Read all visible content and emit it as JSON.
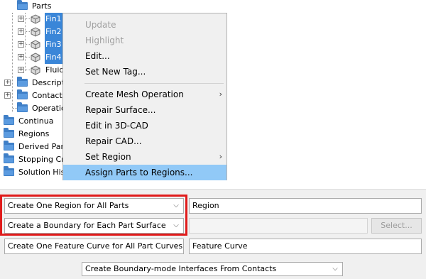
{
  "tree": {
    "items": [
      {
        "label": "Parts",
        "kind": "folder"
      },
      {
        "label": "Fin1",
        "kind": "part",
        "selected": true
      },
      {
        "label": "Fin2",
        "kind": "part",
        "selected": true
      },
      {
        "label": "Fin3",
        "kind": "part",
        "selected": true
      },
      {
        "label": "Fin4",
        "kind": "part",
        "selected": true
      },
      {
        "label": "Fluid",
        "kind": "part",
        "selected": false
      },
      {
        "label": "Descriptions",
        "kind": "folder"
      },
      {
        "label": "Contacts",
        "kind": "folder"
      },
      {
        "label": "Operations",
        "kind": "folder"
      },
      {
        "label": "Continua",
        "kind": "folder"
      },
      {
        "label": "Regions",
        "kind": "folder"
      },
      {
        "label": "Derived Parts",
        "kind": "folder"
      },
      {
        "label": "Stopping Criteria",
        "kind": "folder"
      },
      {
        "label": "Solution Histories",
        "kind": "folder"
      }
    ]
  },
  "context_menu": {
    "items": [
      {
        "label": "Update",
        "disabled": true
      },
      {
        "label": "Highlight",
        "disabled": true
      },
      {
        "label": "Edit..."
      },
      {
        "label": "Set New Tag..."
      },
      {
        "label": "Create Mesh Operation",
        "submenu": true
      },
      {
        "label": "Repair Surface..."
      },
      {
        "label": "Edit in 3D-CAD"
      },
      {
        "label": "Repair CAD..."
      },
      {
        "label": "Set Region",
        "submenu": true
      },
      {
        "label": "Assign Parts to Regions...",
        "highlighted": true
      }
    ],
    "submenu_arrow": "›"
  },
  "dialog": {
    "region_mode": "Create One Region for All Parts",
    "region_name": "Region",
    "boundary_mode": "Create a Boundary for Each Part Surface",
    "boundary_name": "",
    "select_button": "Select...",
    "feature_curve_mode": "Create One Feature Curve for All Part Curves",
    "feature_curve_name": "Feature Curve",
    "interface_mode": "Create Boundary-mode Interfaces From Contacts"
  },
  "colors": {
    "selection": "#3a86d8",
    "menu_highlight": "#91c9f7",
    "emphasis_box": "#e01b1b"
  }
}
